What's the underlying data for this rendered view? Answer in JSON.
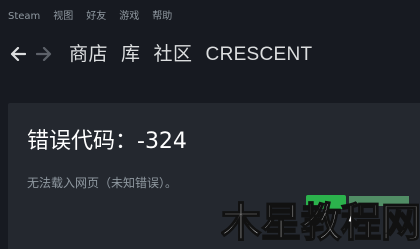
{
  "menubar": {
    "items": [
      "Steam",
      "视图",
      "好友",
      "游戏",
      "帮助"
    ]
  },
  "nav": {
    "back_icon": "arrow-left-icon",
    "forward_icon": "arrow-right-icon",
    "links": [
      "商店",
      "库",
      "社区",
      "CRESCENT"
    ]
  },
  "error": {
    "title": "错误代码：-324",
    "description": "无法载入网页（未知错误）。"
  },
  "watermark": {
    "text": "木星教程网"
  },
  "colors": {
    "background": "#171a21",
    "panel": "#24282f",
    "menu_text": "#8f98a0",
    "nav_text": "#dcdedf",
    "title_text": "#ffffff",
    "watermark_green": "#2bb24c"
  }
}
